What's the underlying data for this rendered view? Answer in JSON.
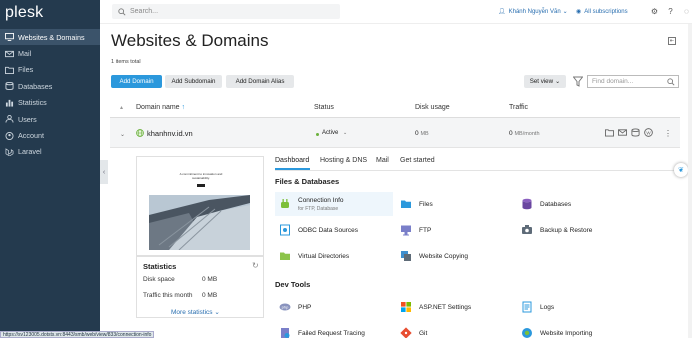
{
  "app": {
    "logo": "plesk"
  },
  "sidebar": {
    "items": [
      {
        "label": "Websites & Domains",
        "icon": "monitor-icon",
        "active": true
      },
      {
        "label": "Mail",
        "icon": "mail-icon"
      },
      {
        "label": "Files",
        "icon": "folder-icon"
      },
      {
        "label": "Databases",
        "icon": "database-icon"
      },
      {
        "label": "Statistics",
        "icon": "chart-icon"
      },
      {
        "label": "Users",
        "icon": "user-icon"
      },
      {
        "label": "Account",
        "icon": "account-icon"
      },
      {
        "label": "Laravel",
        "icon": "laravel-icon"
      }
    ]
  },
  "header": {
    "search_placeholder": "Search...",
    "user": "Khánh Nguyễn Văn",
    "subscriptions": "All subscriptions"
  },
  "page": {
    "title": "Websites & Domains",
    "items_total": "1 items total",
    "buttons": {
      "add_domain": "Add Domain",
      "add_subdomain": "Add Subdomain",
      "add_alias": "Add Domain Alias",
      "set_view": "Set view"
    },
    "find_placeholder": "Find domain..."
  },
  "table": {
    "headers": {
      "name": "Domain name",
      "status": "Status",
      "disk": "Disk usage",
      "traffic": "Traffic"
    },
    "row": {
      "domain": "khanhnv.id.vn",
      "status": "Active",
      "disk_value": "0",
      "disk_unit": "MB",
      "traffic_value": "0",
      "traffic_unit": "MB/month"
    }
  },
  "preview": {
    "tagline": "A commitment to innovation and sustainability."
  },
  "statistics": {
    "title": "Statistics",
    "disk_label": "Disk space",
    "disk_value": "0 MB",
    "traffic_label": "Traffic this month",
    "traffic_value": "0 MB",
    "more": "More statistics"
  },
  "tabs": [
    "Dashboard",
    "Hosting & DNS",
    "Mail",
    "Get started"
  ],
  "sections": {
    "files": {
      "title": "Files & Databases",
      "items": [
        {
          "label": "Connection Info",
          "sub": "for FTP, Database",
          "icon": "plug-icon"
        },
        {
          "label": "Files",
          "icon": "folder-icon"
        },
        {
          "label": "Databases",
          "icon": "database-icon"
        },
        {
          "label": "ODBC Data Sources",
          "icon": "odbc-icon"
        },
        {
          "label": "FTP",
          "icon": "ftp-icon"
        },
        {
          "label": "Backup & Restore",
          "icon": "backup-icon"
        },
        {
          "label": "Virtual Directories",
          "icon": "vdir-icon"
        },
        {
          "label": "Website Copying",
          "icon": "copy-icon"
        }
      ]
    },
    "dev": {
      "title": "Dev Tools",
      "items": [
        {
          "label": "PHP",
          "icon": "php-icon"
        },
        {
          "label": "ASP.NET Settings",
          "icon": "aspnet-icon"
        },
        {
          "label": "Logs",
          "icon": "logs-icon"
        },
        {
          "label": "Failed Request Tracing",
          "icon": "trace-icon"
        },
        {
          "label": "Git",
          "icon": "git-icon"
        },
        {
          "label": "Website Importing",
          "icon": "import-icon"
        }
      ]
    }
  },
  "statusbar": "https://sv123005.dotsts.vn:8443/smb/web/view/833/connection-info",
  "colors": {
    "accent": "#2b98dc",
    "sidebar": "#243a4e",
    "active_status": "#6bb13c"
  }
}
